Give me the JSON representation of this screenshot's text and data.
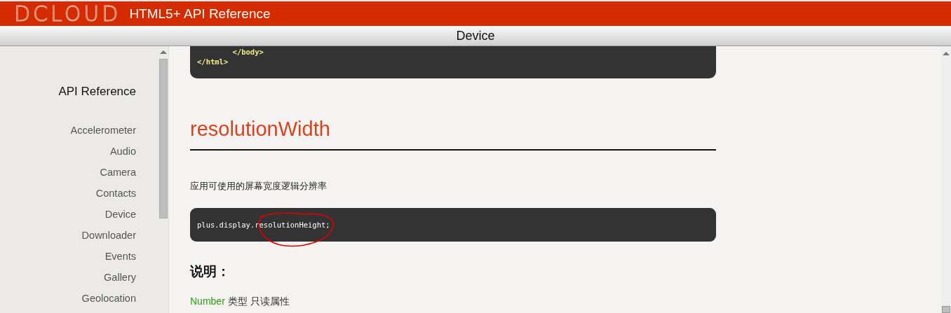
{
  "header": {
    "logo": "DCLOUD",
    "title": "HTML5+ API Reference"
  },
  "title_bar": {
    "title": "Device"
  },
  "sidebar": {
    "heading": "API Reference",
    "items": [
      {
        "label": "Accelerometer"
      },
      {
        "label": "Audio"
      },
      {
        "label": "Camera"
      },
      {
        "label": "Contacts"
      },
      {
        "label": "Device"
      },
      {
        "label": "Downloader"
      },
      {
        "label": "Events"
      },
      {
        "label": "Gallery"
      },
      {
        "label": "Geolocation"
      }
    ]
  },
  "content": {
    "code_top": [
      "        </body>",
      "</html>"
    ],
    "heading": "resolutionWidth",
    "description": "应用可使用的屏幕宽度逻辑分辨率",
    "code": "plus.display.resolutionHeight;",
    "section_heading": "说明：",
    "type_name": "Number",
    "type_text": "类型 只读属性"
  }
}
